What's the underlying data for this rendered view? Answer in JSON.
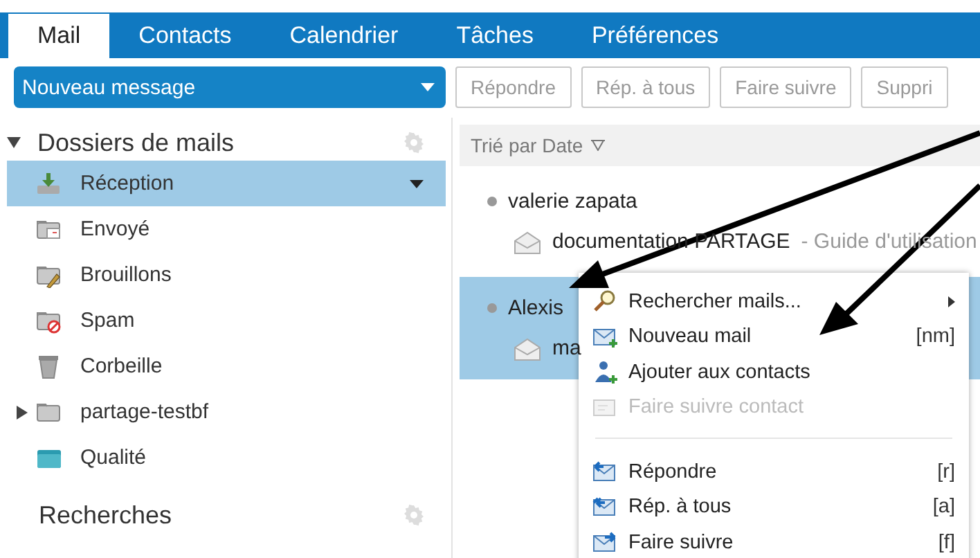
{
  "tabs": [
    {
      "label": "Mail",
      "selected": true
    },
    {
      "label": "Contacts",
      "selected": false
    },
    {
      "label": "Calendrier",
      "selected": false
    },
    {
      "label": "Tâches",
      "selected": false
    },
    {
      "label": "Préférences",
      "selected": false
    }
  ],
  "new_message": {
    "label": "Nouveau message"
  },
  "toolbar": [
    {
      "label": "Répondre"
    },
    {
      "label": "Rép. à tous"
    },
    {
      "label": "Faire suivre"
    },
    {
      "label": "Suppri"
    }
  ],
  "sidebar": {
    "header": {
      "label": "Dossiers de mails",
      "expanded": true
    },
    "folders": [
      {
        "kind": "inbox",
        "label": "Réception",
        "selected": true
      },
      {
        "kind": "sent",
        "label": "Envoyé",
        "selected": false
      },
      {
        "kind": "drafts",
        "label": "Brouillons",
        "selected": false
      },
      {
        "kind": "spam",
        "label": "Spam",
        "selected": false
      },
      {
        "kind": "trash",
        "label": "Corbeille",
        "selected": false
      },
      {
        "kind": "folder",
        "label": "partage-testbf",
        "selected": false,
        "expanded": false
      },
      {
        "kind": "teal-folder",
        "label": "Qualité",
        "selected": false
      }
    ],
    "searches": {
      "label": "Recherches"
    }
  },
  "message_list": {
    "sort_label": "Trié par Date",
    "messages": [
      {
        "sender": "valerie zapata",
        "subject": "documentation PARTAGE",
        "preview": "- Guide d'utilisation",
        "selected": false
      },
      {
        "sender": "Alexis",
        "subject": "ma",
        "selected": true
      }
    ]
  },
  "context_menu": {
    "items": [
      {
        "kind": "search",
        "label": "Rechercher mails...",
        "submenu": true,
        "disabled": false
      },
      {
        "kind": "new-mail",
        "label": "Nouveau mail",
        "shortcut": "[nm]",
        "submenu": false,
        "disabled": false
      },
      {
        "kind": "add-contact",
        "label": "Ajouter aux contacts",
        "submenu": false,
        "disabled": false
      },
      {
        "kind": "forward-contact",
        "label": "Faire suivre contact",
        "submenu": false,
        "disabled": true
      },
      {
        "kind": "separator"
      },
      {
        "kind": "reply",
        "label": "Répondre",
        "shortcut": "[r]",
        "submenu": false,
        "disabled": false
      },
      {
        "kind": "reply-all",
        "label": "Rép. à tous",
        "shortcut": "[a]",
        "submenu": false,
        "disabled": false
      },
      {
        "kind": "forward",
        "label": "Faire suivre",
        "shortcut": "[f]",
        "submenu": false,
        "disabled": false
      }
    ]
  }
}
